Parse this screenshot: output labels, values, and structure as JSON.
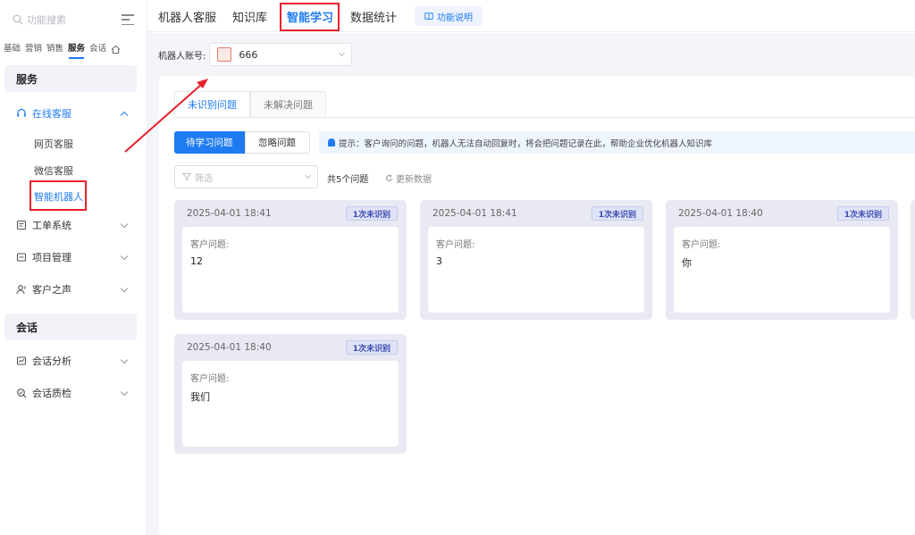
{
  "sidebar": {
    "search_placeholder": "功能搜索",
    "categories": [
      "基础",
      "营销",
      "销售",
      "服务",
      "会话"
    ],
    "service_header": "服务",
    "online_service": "在线客服",
    "sub_items": [
      "网页客服",
      "微信客服",
      "智能机器人"
    ],
    "ticket_system": "工单系统",
    "project_mgmt": "项目管理",
    "customer_voice": "客户之声",
    "session_header": "会话",
    "session_analysis": "会话分析",
    "session_qc": "会话质检"
  },
  "topbar": {
    "tabs": [
      "机器人客服",
      "知识库",
      "智能学习",
      "数据统计"
    ],
    "func_btn": "功能说明"
  },
  "robot": {
    "label": "机器人账号:",
    "value": "666"
  },
  "tabs": {
    "unrecognized": "未识别问题",
    "unresolved": "未解决问题"
  },
  "segment": {
    "pending": "待学习问题",
    "ignored": "忽略问题"
  },
  "tip": "提示：客户询问的问题，机器人无法自动回复时，将会把问题记录在此，帮助企业优化机器人知识库",
  "filter": {
    "placeholder": "筛选",
    "count": "共5个问题",
    "refresh": "更新数据"
  },
  "cards": [
    {
      "time": "2025-04-01 18:41",
      "badge": "1次未识别",
      "label": "客户问题:",
      "question": "12"
    },
    {
      "time": "2025-04-01 18:41",
      "badge": "1次未识别",
      "label": "客户问题:",
      "question": "3"
    },
    {
      "time": "2025-04-01 18:40",
      "badge": "1次未识别",
      "label": "客户问题:",
      "question": "你"
    },
    {
      "time": "2025-04-01 18:40",
      "badge": "1次未识别",
      "label": "客户问题:",
      "question": "我们"
    }
  ],
  "colors": {
    "accent": "#1e7bf0",
    "annotation": "#e8202a",
    "card_bg": "#e8e9f2"
  }
}
